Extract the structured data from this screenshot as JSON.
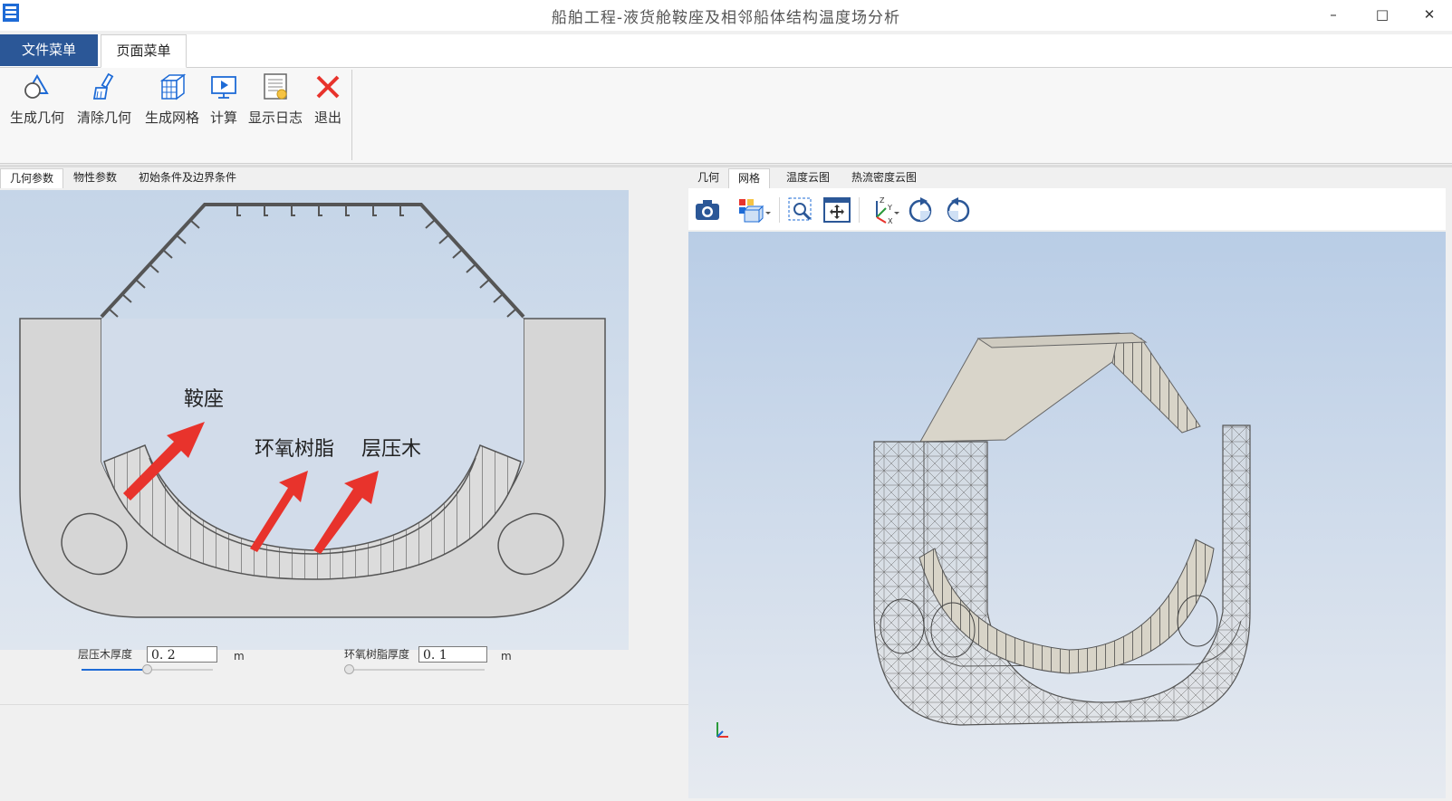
{
  "window": {
    "title": "船舶工程-液货舱鞍座及相邻船体结构温度场分析",
    "min": "–",
    "max": "□",
    "close": "✕"
  },
  "menu_tabs": [
    "文件菜单",
    "页面菜单"
  ],
  "ribbon": {
    "buttons": [
      {
        "label": "生成几何",
        "icon": "generate-geometry-icon"
      },
      {
        "label": "清除几何",
        "icon": "brush-icon"
      },
      {
        "label": "生成网格",
        "icon": "mesh-cube-icon"
      },
      {
        "label": "计算",
        "icon": "monitor-play-icon"
      },
      {
        "label": "显示日志",
        "icon": "log-icon"
      },
      {
        "label": "退出",
        "icon": "close-x-icon"
      }
    ]
  },
  "left_tabs": [
    "几何参数",
    "物性参数",
    "初始条件及边界条件"
  ],
  "right_tabs": [
    "几何",
    "网格",
    "温度云图",
    "热流密度云图"
  ],
  "diagram": {
    "labels": [
      "鞍座",
      "环氧树脂",
      "层压木"
    ],
    "colors": {
      "arrow": "#e8332c",
      "structure": "#d6d6d6"
    }
  },
  "params": {
    "laminate": {
      "label": "层压木厚度",
      "value": "0. 2",
      "unit": "m",
      "slider_fraction": 0.5
    },
    "epoxy": {
      "label": "环氧树脂厚度",
      "value": "0. 1",
      "unit": "m",
      "slider_fraction": 0.0
    }
  },
  "viewer_toolbar": [
    "camera-icon",
    "view-cube-icon",
    "zoom-window-icon",
    "pan-fit-icon",
    "axis-triad-icon",
    "rotate-cw-icon",
    "rotate-ccw-icon"
  ],
  "colors": {
    "accent": "#2b5797",
    "slider": "#1e6bd6"
  }
}
